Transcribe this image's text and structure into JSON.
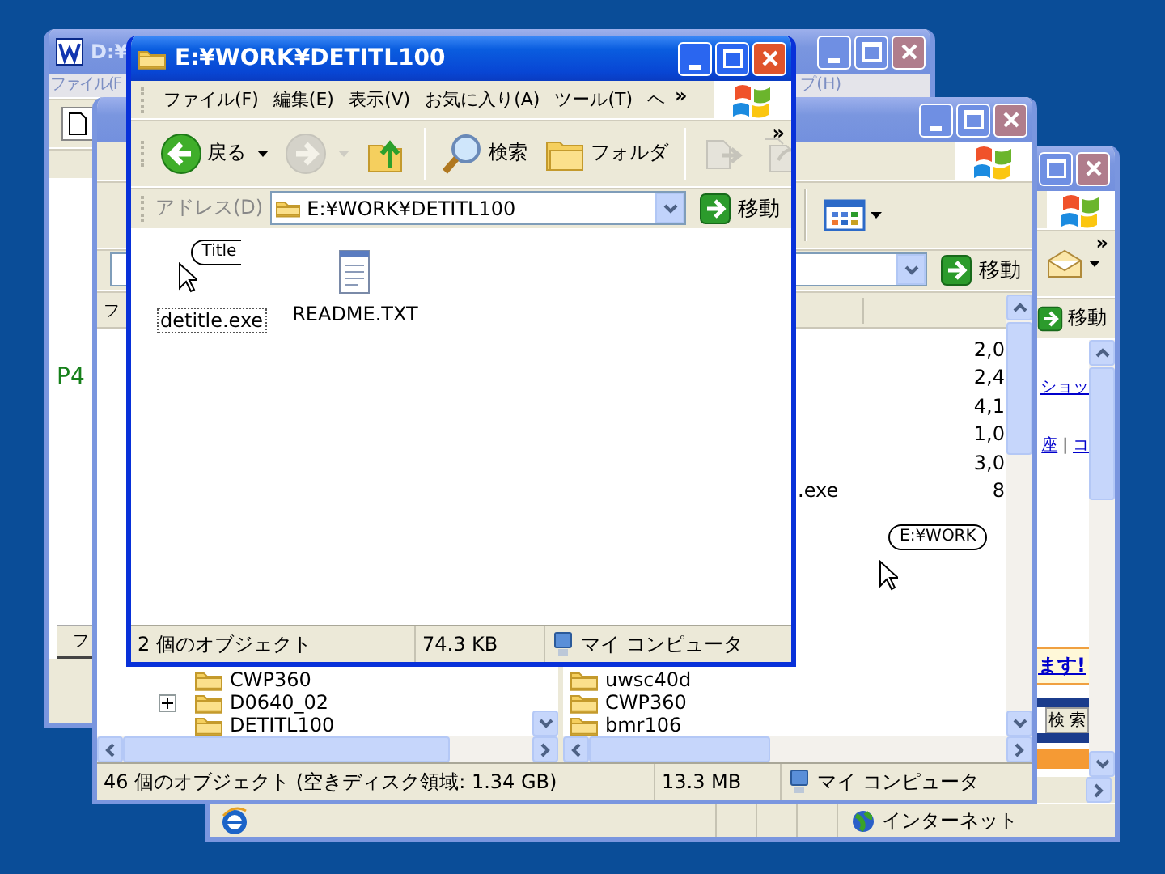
{
  "editor_window": {
    "active": false,
    "title": "D:¥",
    "menu": [
      "ファイル(F",
      "プ(H)"
    ],
    "body_text": "P4",
    "tab": "フ"
  },
  "browser_window": {
    "active": false,
    "go_button": "移動",
    "toolbar_chevron": "»",
    "page_rows": [
      {
        "kind": "links",
        "items": [
          "ショッ"
        ]
      },
      {
        "kind": "links",
        "items": [
          "座",
          "コ"
        ],
        "separator": "|"
      },
      {
        "kind": "banner",
        "text": "ます!"
      },
      {
        "kind": "search",
        "text": "検 索"
      },
      {
        "kind": "bar"
      }
    ],
    "status": "インターネット"
  },
  "explorer_window": {
    "active": false,
    "go_button": "移動",
    "tree_header": "フ",
    "file_rows": [
      {
        "size": "2,0"
      },
      {
        "size": "2,4"
      },
      {
        "size": "4,1"
      },
      {
        "size": "1,0"
      },
      {
        "size": "3,0"
      },
      {
        "name": ".exe",
        "size": "8"
      }
    ],
    "lower_files": [
      "uwsc40d",
      "CWP360",
      "bmr106"
    ],
    "tree_items": [
      {
        "label": "CWP360",
        "expandable": false
      },
      {
        "label": "D0640_02",
        "expandable": true
      },
      {
        "label": "DETITL100",
        "expandable": false
      }
    ],
    "tooltip": "E:¥WORK",
    "status": [
      "46 個のオブジェクト (空きディスク領域: 1.34 GB)",
      "13.3 MB",
      "マイ コンピュータ"
    ]
  },
  "front_window": {
    "active": true,
    "title": "E:¥WORK¥DETITL100",
    "menu": [
      "ファイル(F)",
      "編集(E)",
      "表示(V)",
      "お気に入り(A)",
      "ツール(T)",
      "ヘ"
    ],
    "menu_chevron": "»",
    "toolbar_chevron": "»",
    "toolbar": [
      {
        "kind": "back",
        "label": "戻る",
        "disabled": false
      },
      {
        "kind": "forward",
        "disabled": true
      },
      {
        "kind": "up",
        "disabled": false
      },
      {
        "kind": "search",
        "label": "検索",
        "disabled": false
      },
      {
        "kind": "folders",
        "label": "フォルダ",
        "disabled": false
      },
      {
        "kind": "move",
        "disabled": true
      },
      {
        "kind": "copy",
        "disabled": true
      }
    ],
    "address_label": "アドレス(D)",
    "address": "E:¥WORK¥DETITL100",
    "go_button": "移動",
    "files": [
      {
        "name": "detitle.exe",
        "kind": "program",
        "selected": true,
        "icon_text": "Title"
      },
      {
        "name": "README.TXT",
        "kind": "text",
        "selected": false
      }
    ],
    "status": [
      "2 個のオブジェクト",
      "74.3 KB",
      "マイ コンピュータ"
    ]
  }
}
